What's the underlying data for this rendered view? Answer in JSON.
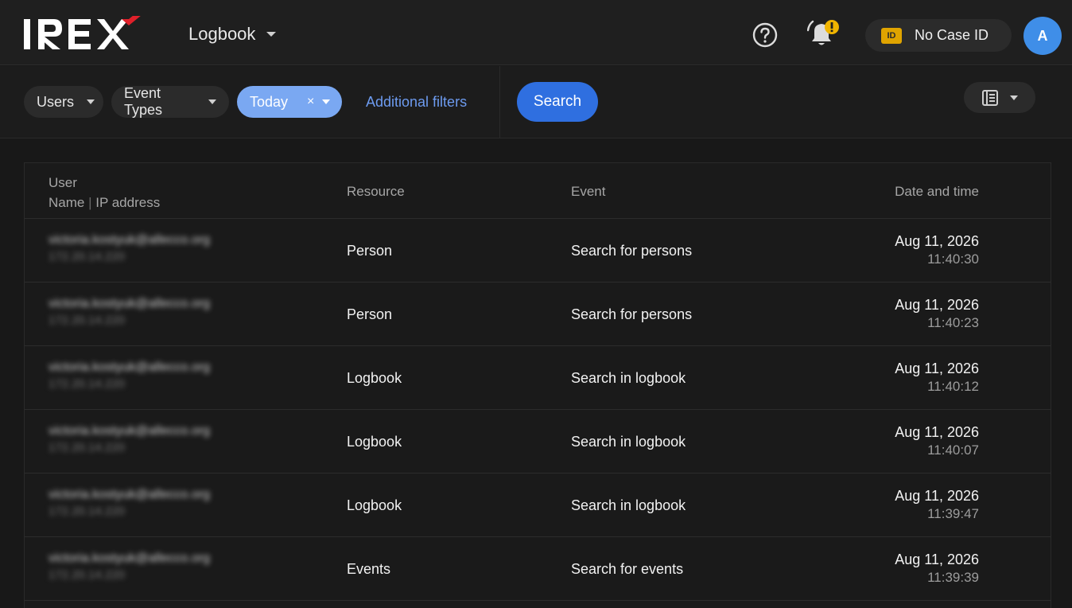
{
  "header": {
    "logo_text": "IREX",
    "app_name": "Logbook",
    "case_badge": "ID",
    "case_label": "No Case ID",
    "avatar_initial": "A",
    "colors": {
      "accent": "#2f6fe0",
      "logo_accent": "#e0202a",
      "warning": "#f0b400",
      "avatar": "#3f8ee8"
    }
  },
  "filters": {
    "users_label": "Users",
    "event_types_label": "Event Types",
    "date_label": "Today",
    "date_clear": "×",
    "additional_label": "Additional filters",
    "search_label": "Search"
  },
  "table": {
    "headers": {
      "user": "User",
      "user_sub_name": "Name",
      "user_sub_sep": "|",
      "user_sub_ip": "IP address",
      "resource": "Resource",
      "event": "Event",
      "date": "Date and time"
    },
    "rows": [
      {
        "email": "victoria.kostyuk@allecco.org",
        "ip": "172.20.14.220",
        "resource": "Person",
        "event": "Search for persons",
        "date": "Aug 11, 2026",
        "time": "11:40:30"
      },
      {
        "email": "victoria.kostyuk@allecco.org",
        "ip": "172.20.14.220",
        "resource": "Person",
        "event": "Search for persons",
        "date": "Aug 11, 2026",
        "time": "11:40:23"
      },
      {
        "email": "victoria.kostyuk@allecco.org",
        "ip": "172.20.14.220",
        "resource": "Logbook",
        "event": "Search in logbook",
        "date": "Aug 11, 2026",
        "time": "11:40:12"
      },
      {
        "email": "victoria.kostyuk@allecco.org",
        "ip": "172.20.14.220",
        "resource": "Logbook",
        "event": "Search in logbook",
        "date": "Aug 11, 2026",
        "time": "11:40:07"
      },
      {
        "email": "victoria.kostyuk@allecco.org",
        "ip": "172.20.14.220",
        "resource": "Logbook",
        "event": "Search in logbook",
        "date": "Aug 11, 2026",
        "time": "11:39:47"
      },
      {
        "email": "victoria.kostyuk@allecco.org",
        "ip": "172.20.14.220",
        "resource": "Events",
        "event": "Search for events",
        "date": "Aug 11, 2026",
        "time": "11:39:39"
      }
    ]
  }
}
